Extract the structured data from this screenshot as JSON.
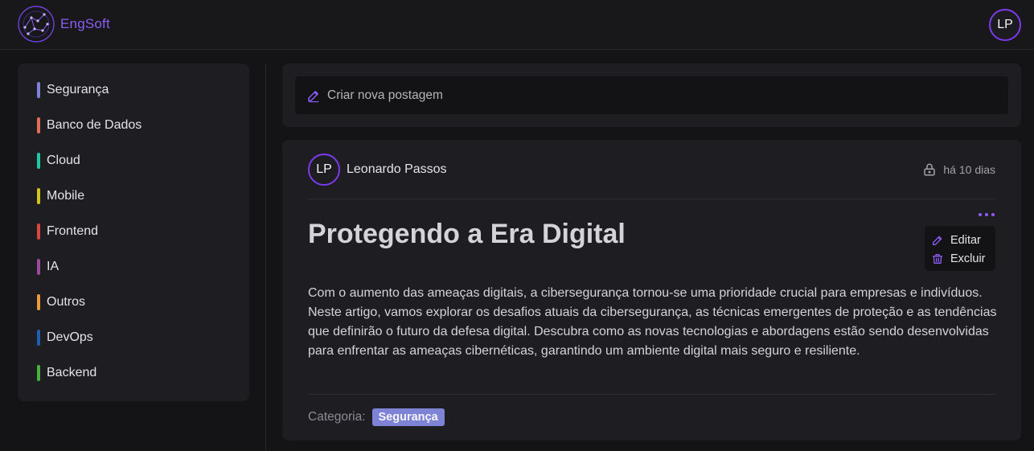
{
  "app": {
    "brand": "EngSoft",
    "user_initials": "LP"
  },
  "sidebar": {
    "items": [
      {
        "label": "Segurança",
        "color": "#7e83d6"
      },
      {
        "label": "Banco de Dados",
        "color": "#e26f55"
      },
      {
        "label": "Cloud",
        "color": "#1fc8a6"
      },
      {
        "label": "Mobile",
        "color": "#d4c51c"
      },
      {
        "label": "Frontend",
        "color": "#d9473f"
      },
      {
        "label": "IA",
        "color": "#9b4aa0"
      },
      {
        "label": "Outros",
        "color": "#e89a3c"
      },
      {
        "label": "DevOps",
        "color": "#1e5fb0"
      },
      {
        "label": "Backend",
        "color": "#46b33f"
      }
    ]
  },
  "composer": {
    "label": "Criar nova postagem"
  },
  "post": {
    "author_initials": "LP",
    "author": "Leonardo Passos",
    "time": "há 10 dias",
    "title": "Protegendo a Era Digital",
    "menu": {
      "edit": "Editar",
      "delete": "Excluir"
    },
    "body": "Com o aumento das ameaças digitais, a cibersegurança tornou-se uma prioridade crucial para empresas e indivíduos. Neste artigo, vamos explorar os desafios atuais da cibersegurança, as técnicas emergentes de proteção e as tendências que definirão o futuro da defesa digital. Descubra como as novas tecnologias e abordagens estão sendo desenvolvidas para enfrentar as ameaças cibernéticas, garantindo um ambiente digital mais seguro e resiliente.",
    "category_label": "Categoria:",
    "category": "Segurança",
    "category_color": "#7e83d6"
  },
  "icons": {
    "logo": "constellation-logo-icon",
    "compose": "pencil-icon",
    "visibility": "lock-icon",
    "more": "more-dots-icon",
    "edit": "pencil-icon",
    "delete": "trash-icon"
  }
}
